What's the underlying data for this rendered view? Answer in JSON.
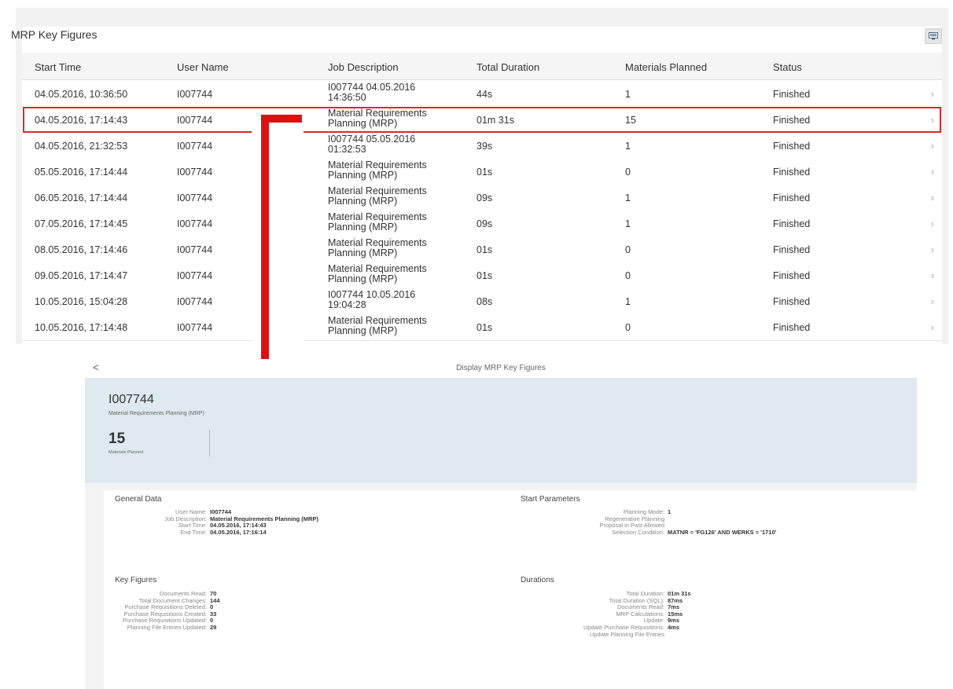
{
  "list": {
    "title": "MRP Key Figures",
    "settings_icon": "display-settings-icon",
    "columns": [
      "Start Time",
      "User Name",
      "Job Description",
      "Total Duration",
      "Materials Planned",
      "Status"
    ],
    "rows": [
      {
        "start": "04.05.2016, 10:36:50",
        "user": "I007744",
        "desc1": "I007744 04.05.2016",
        "desc2": "14:36:50",
        "duration": "44s",
        "materials": "1",
        "status": "Finished"
      },
      {
        "start": "04.05.2016, 17:14:43",
        "user": "I007744",
        "desc1": "Material Requirements",
        "desc2": "Planning (MRP)",
        "duration": "01m 31s",
        "materials": "15",
        "status": "Finished"
      },
      {
        "start": "04.05.2016, 21:32:53",
        "user": "I007744",
        "desc1": "I007744 05.05.2016",
        "desc2": "01:32:53",
        "duration": "39s",
        "materials": "1",
        "status": "Finished"
      },
      {
        "start": "05.05.2016, 17:14:44",
        "user": "I007744",
        "desc1": "Material Requirements",
        "desc2": "Planning (MRP)",
        "duration": "01s",
        "materials": "0",
        "status": "Finished"
      },
      {
        "start": "06.05.2016, 17:14:44",
        "user": "I007744",
        "desc1": "Material Requirements",
        "desc2": "Planning (MRP)",
        "duration": "09s",
        "materials": "1",
        "status": "Finished"
      },
      {
        "start": "07.05.2016, 17:14:45",
        "user": "I007744",
        "desc1": "Material Requirements",
        "desc2": "Planning (MRP)",
        "duration": "09s",
        "materials": "1",
        "status": "Finished"
      },
      {
        "start": "08.05.2016, 17:14:46",
        "user": "I007744",
        "desc1": "Material Requirements",
        "desc2": "Planning (MRP)",
        "duration": "01s",
        "materials": "0",
        "status": "Finished"
      },
      {
        "start": "09.05.2016, 17:14:47",
        "user": "I007744",
        "desc1": "Material Requirements",
        "desc2": "Planning (MRP)",
        "duration": "01s",
        "materials": "0",
        "status": "Finished"
      },
      {
        "start": "10.05.2016, 15:04:28",
        "user": "I007744",
        "desc1": "I007744 10.05.2016",
        "desc2": "19:04:28",
        "duration": "08s",
        "materials": "1",
        "status": "Finished"
      },
      {
        "start": "10.05.2016, 17:14:48",
        "user": "I007744",
        "desc1": "Material Requirements",
        "desc2": "Planning (MRP)",
        "duration": "01s",
        "materials": "0",
        "status": "Finished"
      }
    ],
    "row_chevron": "›",
    "highlight_color": "#d92a2a",
    "arrow_color": "#e01010"
  },
  "detail": {
    "back": "<",
    "nav_title": "Display MRP Key Figures",
    "object_title": "I007744",
    "object_subtitle": "Material Requirements Planning (MRP)",
    "kpi_value": "15",
    "kpi_label": "Materials Planned",
    "header_color": "#deeaf0",
    "general": {
      "title": "General Data",
      "items": [
        {
          "k": "User Name:",
          "v": "I007744"
        },
        {
          "k": "Job Description:",
          "v": "Material Requirements Planning (MRP)"
        },
        {
          "k": "Start Time:",
          "v": "04.05.2016, 17:14:43"
        },
        {
          "k": "End Time:",
          "v": "04.05.2016, 17:16:14"
        }
      ]
    },
    "start_params": {
      "title": "Start Parameters",
      "items": [
        {
          "k": "Planning Mode:",
          "v": "1"
        },
        {
          "k": "Regenerative Planning",
          "v": ""
        },
        {
          "k": "Proposal in Past Allowed",
          "v": ""
        },
        {
          "k": "Selection Condition:",
          "v": "MATNR = 'FG126' AND WERKS = '1710'"
        }
      ]
    },
    "key_figures": {
      "title": "Key Figures",
      "items": [
        {
          "k": "Documents Read:",
          "v": "70"
        },
        {
          "k": "Total Document Changes:",
          "v": "144"
        },
        {
          "k": "Purchase Requisitions Deleted:",
          "v": "0"
        },
        {
          "k": "Purchase Requisitions Created:",
          "v": "33"
        },
        {
          "k": "Purchase Requisitions Updated:",
          "v": "0"
        },
        {
          "k": "Planning File Entries Updated:",
          "v": "29"
        }
      ]
    },
    "durations": {
      "title": "Durations",
      "items": [
        {
          "k": "Total Duration:",
          "v": "01m 31s"
        },
        {
          "k": "Total Duration (SQL):",
          "v": "87ms"
        },
        {
          "k": "Documents Read:",
          "v": "7ms"
        },
        {
          "k": "MRP Calculations:",
          "v": "15ms"
        },
        {
          "k": "Update:",
          "v": "9ms"
        },
        {
          "k": "Update Purchase Requisitions:",
          "v": "4ms"
        },
        {
          "k": "Update Planning File Entries",
          "v": ""
        }
      ]
    }
  }
}
